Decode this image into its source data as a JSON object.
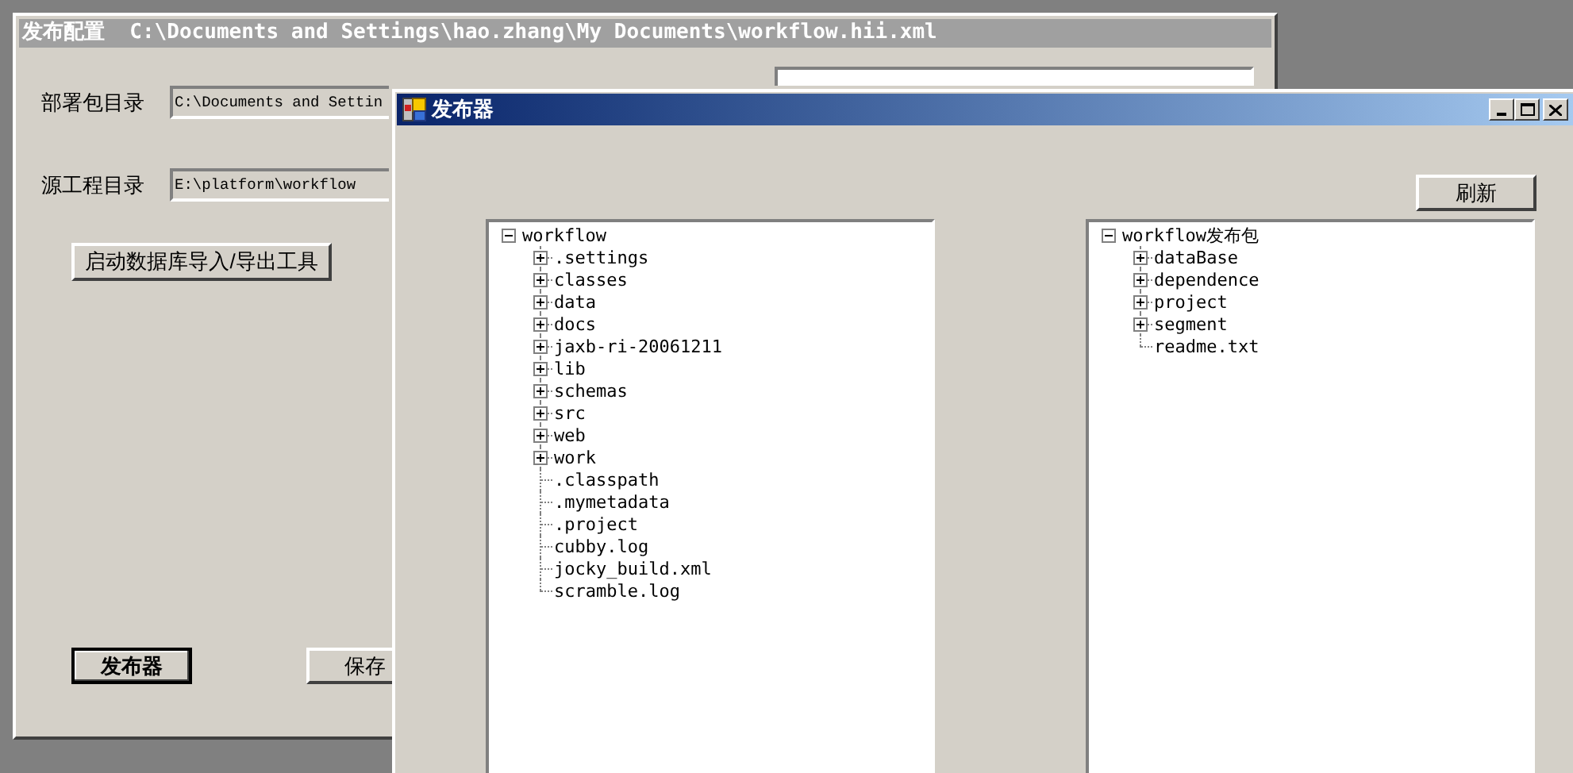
{
  "config_window": {
    "title": "发布配置  C:\\Documents and Settings\\hao.zhang\\My Documents\\workflow.hii.xml",
    "active": false,
    "fields": [
      {
        "label": "部署包目录",
        "value": "C:\\Documents and Settin"
      },
      {
        "label": "源工程目录",
        "value": "E:\\platform\\workflow"
      }
    ],
    "db_tool_button": "启动数据库导入/导出工具",
    "buttons": [
      {
        "label": "发布器",
        "default": true
      },
      {
        "label": "保存",
        "default": false
      }
    ]
  },
  "publisher_window": {
    "title": "发布器",
    "active": true,
    "refresh_button": "刷新",
    "trees": [
      {
        "label": "workflow",
        "kind": "folder",
        "expanded": true,
        "children": [
          {
            "label": ".settings",
            "kind": "folder",
            "expanded": false
          },
          {
            "label": "classes",
            "kind": "folder",
            "expanded": false
          },
          {
            "label": "data",
            "kind": "folder",
            "expanded": false
          },
          {
            "label": "docs",
            "kind": "folder",
            "expanded": false
          },
          {
            "label": "jaxb-ri-20061211",
            "kind": "folder",
            "expanded": false
          },
          {
            "label": "lib",
            "kind": "folder",
            "expanded": false
          },
          {
            "label": "schemas",
            "kind": "folder",
            "expanded": false
          },
          {
            "label": "src",
            "kind": "folder",
            "expanded": false
          },
          {
            "label": "web",
            "kind": "folder",
            "expanded": false
          },
          {
            "label": "work",
            "kind": "folder",
            "expanded": false
          },
          {
            "label": ".classpath",
            "kind": "file"
          },
          {
            "label": ".mymetadata",
            "kind": "file"
          },
          {
            "label": ".project",
            "kind": "file"
          },
          {
            "label": "cubby.log",
            "kind": "file"
          },
          {
            "label": "jocky_build.xml",
            "kind": "file"
          },
          {
            "label": "scramble.log",
            "kind": "file"
          }
        ]
      },
      {
        "label": "workflow发布包",
        "kind": "folder",
        "expanded": true,
        "children": [
          {
            "label": "dataBase",
            "kind": "folder",
            "expanded": false
          },
          {
            "label": "dependence",
            "kind": "folder",
            "expanded": false
          },
          {
            "label": "project",
            "kind": "folder",
            "expanded": false
          },
          {
            "label": "segment",
            "kind": "folder",
            "expanded": false
          },
          {
            "label": "readme.txt",
            "kind": "file"
          }
        ]
      }
    ]
  }
}
